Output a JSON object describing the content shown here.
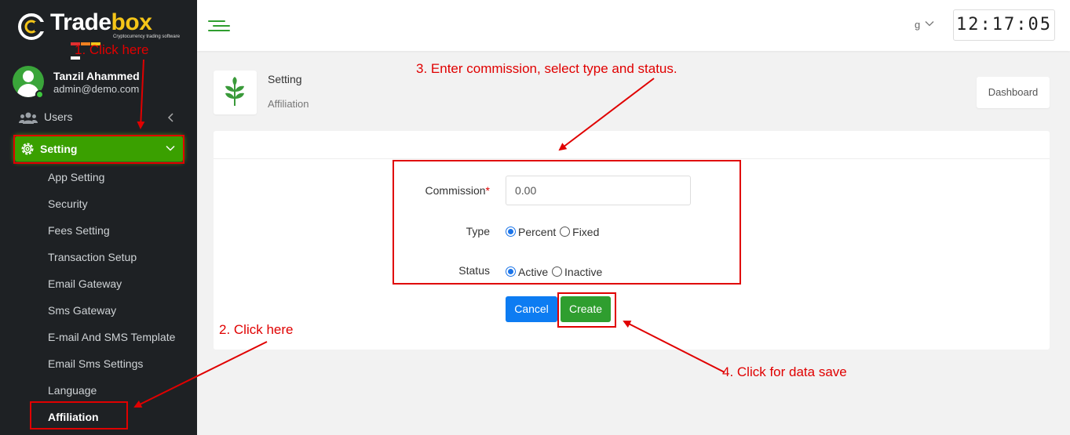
{
  "sidebar": {
    "logo": {
      "text_main": "Trade",
      "text_accent": "box",
      "tagline": "Cryptocurrency trading software"
    },
    "user": {
      "name": "Tanzil Ahammed",
      "email": "admin@demo.com"
    },
    "nav": {
      "users_label": "Users",
      "setting_label": "Setting",
      "submenu": [
        "App Setting",
        "Security",
        "Fees Setting",
        "Transaction Setup",
        "Email Gateway",
        "Sms Gateway",
        "E-mail And SMS Template",
        "Email Sms Settings",
        "Language",
        "Affiliation"
      ]
    }
  },
  "topbar": {
    "language": "g",
    "clock": "12:17:05"
  },
  "page": {
    "title": "Setting",
    "subtitle": "Affiliation",
    "dashboard_button": "Dashboard"
  },
  "form": {
    "commission_label": "Commission",
    "required_mark": "*",
    "commission_placeholder": "0.00",
    "type_label": "Type",
    "type_options": [
      "Percent",
      "Fixed"
    ],
    "type_selected": "Percent",
    "status_label": "Status",
    "status_options": [
      "Active",
      "Inactive"
    ],
    "status_selected": "Active",
    "cancel_label": "Cancel",
    "create_label": "Create"
  },
  "annotations": {
    "step1": "1. Click here",
    "step2": "2. Click here",
    "step3": "3. Enter commission, select type and status.",
    "step4": "4. Click for data save"
  },
  "colors": {
    "sidebar_bg": "#1e2124",
    "accent_green": "#2f9e2f",
    "active_menu_green": "#3aa000",
    "primary_blue": "#0d7cf2",
    "annotation_red": "#e00000",
    "logo_yellow": "#f5c518"
  }
}
